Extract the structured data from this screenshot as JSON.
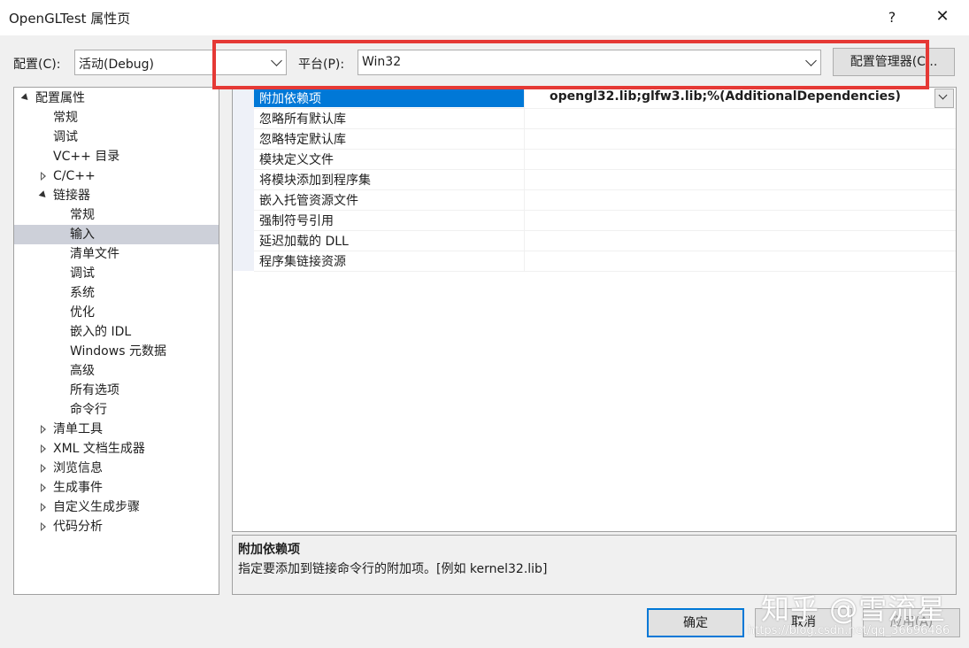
{
  "window": {
    "title": "OpenGLTest 属性页",
    "help_glyph": "?",
    "close_glyph": "✕"
  },
  "toolbar": {
    "config_label": "配置(C):",
    "config_value": "活动(Debug)",
    "platform_label": "平台(P):",
    "platform_value": "Win32",
    "config_manager_label": "配置管理器(C..."
  },
  "tree": {
    "items": [
      {
        "label": "配置属性",
        "level": 0,
        "expander": "expanded"
      },
      {
        "label": "常规",
        "level": 1,
        "expander": "none"
      },
      {
        "label": "调试",
        "level": 1,
        "expander": "none"
      },
      {
        "label": "VC++ 目录",
        "level": 1,
        "expander": "none"
      },
      {
        "label": "C/C++",
        "level": 1,
        "expander": "collapsed"
      },
      {
        "label": "链接器",
        "level": 1,
        "expander": "expanded"
      },
      {
        "label": "常规",
        "level": 2,
        "expander": "none"
      },
      {
        "label": "输入",
        "level": 2,
        "expander": "none",
        "selected": true
      },
      {
        "label": "清单文件",
        "level": 2,
        "expander": "none"
      },
      {
        "label": "调试",
        "level": 2,
        "expander": "none"
      },
      {
        "label": "系统",
        "level": 2,
        "expander": "none"
      },
      {
        "label": "优化",
        "level": 2,
        "expander": "none"
      },
      {
        "label": "嵌入的 IDL",
        "level": 2,
        "expander": "none"
      },
      {
        "label": "Windows 元数据",
        "level": 2,
        "expander": "none"
      },
      {
        "label": "高级",
        "level": 2,
        "expander": "none"
      },
      {
        "label": "所有选项",
        "level": 2,
        "expander": "none"
      },
      {
        "label": "命令行",
        "level": 2,
        "expander": "none"
      },
      {
        "label": "清单工具",
        "level": 1,
        "expander": "collapsed"
      },
      {
        "label": "XML 文档生成器",
        "level": 1,
        "expander": "collapsed"
      },
      {
        "label": "浏览信息",
        "level": 1,
        "expander": "collapsed"
      },
      {
        "label": "生成事件",
        "level": 1,
        "expander": "collapsed"
      },
      {
        "label": "自定义生成步骤",
        "level": 1,
        "expander": "collapsed"
      },
      {
        "label": "代码分析",
        "level": 1,
        "expander": "collapsed"
      }
    ]
  },
  "grid": {
    "rows": [
      {
        "name": "附加依赖项",
        "value": "opengl32.lib;glfw3.lib;%(AdditionalDependencies)",
        "selected": true
      },
      {
        "name": "忽略所有默认库",
        "value": ""
      },
      {
        "name": "忽略特定默认库",
        "value": ""
      },
      {
        "name": "模块定义文件",
        "value": ""
      },
      {
        "name": "将模块添加到程序集",
        "value": ""
      },
      {
        "name": "嵌入托管资源文件",
        "value": ""
      },
      {
        "name": "强制符号引用",
        "value": ""
      },
      {
        "name": "延迟加载的 DLL",
        "value": ""
      },
      {
        "name": "程序集链接资源",
        "value": ""
      }
    ]
  },
  "description": {
    "title": "附加依赖项",
    "text": "指定要添加到链接命令行的附加项。[例如 kernel32.lib]"
  },
  "buttons": {
    "ok": "确定",
    "cancel": "取消",
    "apply": "应用(A)"
  },
  "watermark": {
    "zhihu": "知乎 @雪流星",
    "csdn": "https://blog.csdn.net/qq_36696486"
  },
  "colors": {
    "selection_blue": "#0078d7",
    "highlight_red": "#e53935",
    "tree_selection": "#cdd0d9"
  }
}
